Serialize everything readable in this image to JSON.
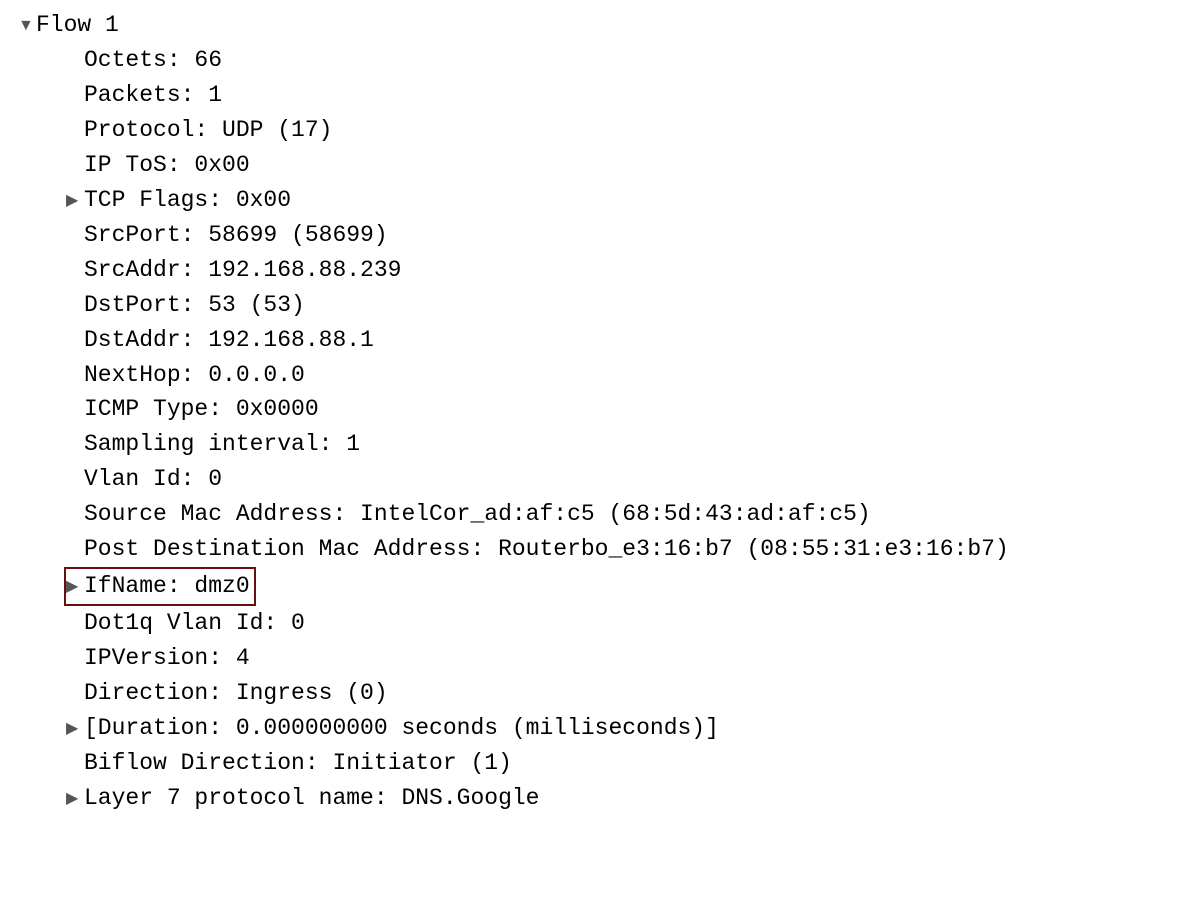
{
  "flow": {
    "title": "Flow 1",
    "fields": [
      {
        "label": "Octets",
        "value": "66",
        "expandable": false,
        "highlighted": false
      },
      {
        "label": "Packets",
        "value": "1",
        "expandable": false,
        "highlighted": false
      },
      {
        "label": "Protocol",
        "value": "UDP (17)",
        "expandable": false,
        "highlighted": false
      },
      {
        "label": "IP ToS",
        "value": "0x00",
        "expandable": false,
        "highlighted": false
      },
      {
        "label": "TCP Flags",
        "value": "0x00",
        "expandable": true,
        "highlighted": false
      },
      {
        "label": "SrcPort",
        "value": "58699 (58699)",
        "expandable": false,
        "highlighted": false
      },
      {
        "label": "SrcAddr",
        "value": "192.168.88.239",
        "expandable": false,
        "highlighted": false
      },
      {
        "label": "DstPort",
        "value": "53 (53)",
        "expandable": false,
        "highlighted": false
      },
      {
        "label": "DstAddr",
        "value": "192.168.88.1",
        "expandable": false,
        "highlighted": false
      },
      {
        "label": "NextHop",
        "value": "0.0.0.0",
        "expandable": false,
        "highlighted": false
      },
      {
        "label": "ICMP Type",
        "value": "0x0000",
        "expandable": false,
        "highlighted": false
      },
      {
        "label": "Sampling interval",
        "value": "1",
        "expandable": false,
        "highlighted": false
      },
      {
        "label": "Vlan Id",
        "value": "0",
        "expandable": false,
        "highlighted": false
      },
      {
        "label": "Source Mac Address",
        "value": "IntelCor_ad:af:c5 (68:5d:43:ad:af:c5)",
        "expandable": false,
        "highlighted": false
      },
      {
        "label": "Post Destination Mac Address",
        "value": "Routerbo_e3:16:b7 (08:55:31:e3:16:b7)",
        "expandable": false,
        "highlighted": false
      },
      {
        "label": "IfName",
        "value": "dmz0",
        "expandable": true,
        "highlighted": true
      },
      {
        "label": "Dot1q Vlan Id",
        "value": "0",
        "expandable": false,
        "highlighted": false
      },
      {
        "label": "IPVersion",
        "value": "4",
        "expandable": false,
        "highlighted": false
      },
      {
        "label": "Direction",
        "value": "Ingress (0)",
        "expandable": false,
        "highlighted": false
      },
      {
        "label": "[Duration",
        "value": "0.000000000 seconds (milliseconds)]",
        "expandable": true,
        "highlighted": false
      },
      {
        "label": "Biflow Direction",
        "value": "Initiator (1)",
        "expandable": false,
        "highlighted": false
      },
      {
        "label": "Layer 7 protocol name",
        "value": "DNS.Google",
        "expandable": true,
        "highlighted": false
      }
    ]
  }
}
